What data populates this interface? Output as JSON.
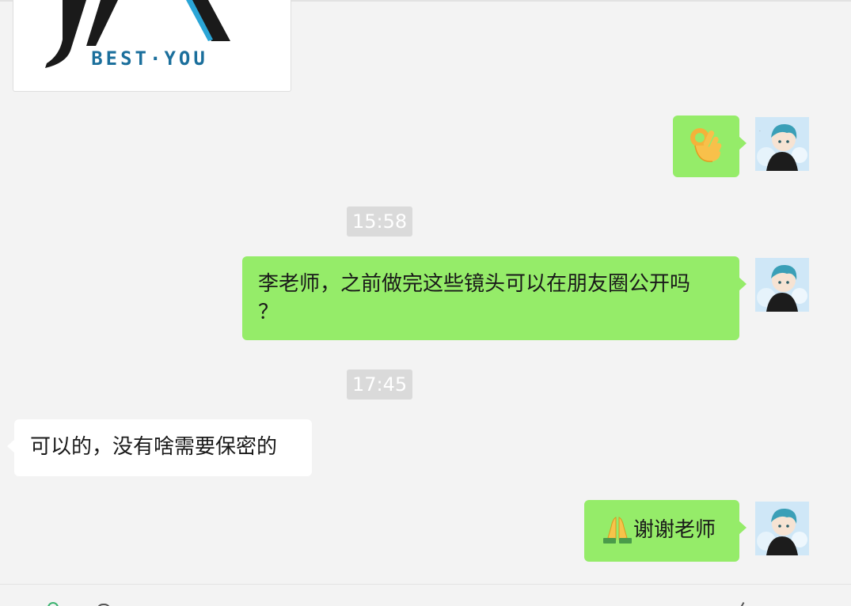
{
  "logo": {
    "text": "BEST·YOU"
  },
  "messages": [
    {
      "sender": "me",
      "content_icon": "ok-hand-emoji"
    },
    {
      "sender": "me",
      "text": "李老师，之前做完这些镜头可以在朋友圈公开吗？",
      "line1": "李老师，之前做完这些镜头可以在朋友圈公开吗",
      "line2": "？"
    },
    {
      "sender": "other",
      "text": "可以的，没有啥需要保密的"
    },
    {
      "sender": "me",
      "emoji_icon": "folded-hands-emoji",
      "text": "谢谢老师"
    }
  ],
  "timestamps": [
    "15:58",
    "17:45"
  ],
  "colors": {
    "my_bubble": "#95ec69",
    "other_bubble": "#ffffff",
    "background": "#f3f3f3",
    "timestamp_bg": "#dadada"
  }
}
